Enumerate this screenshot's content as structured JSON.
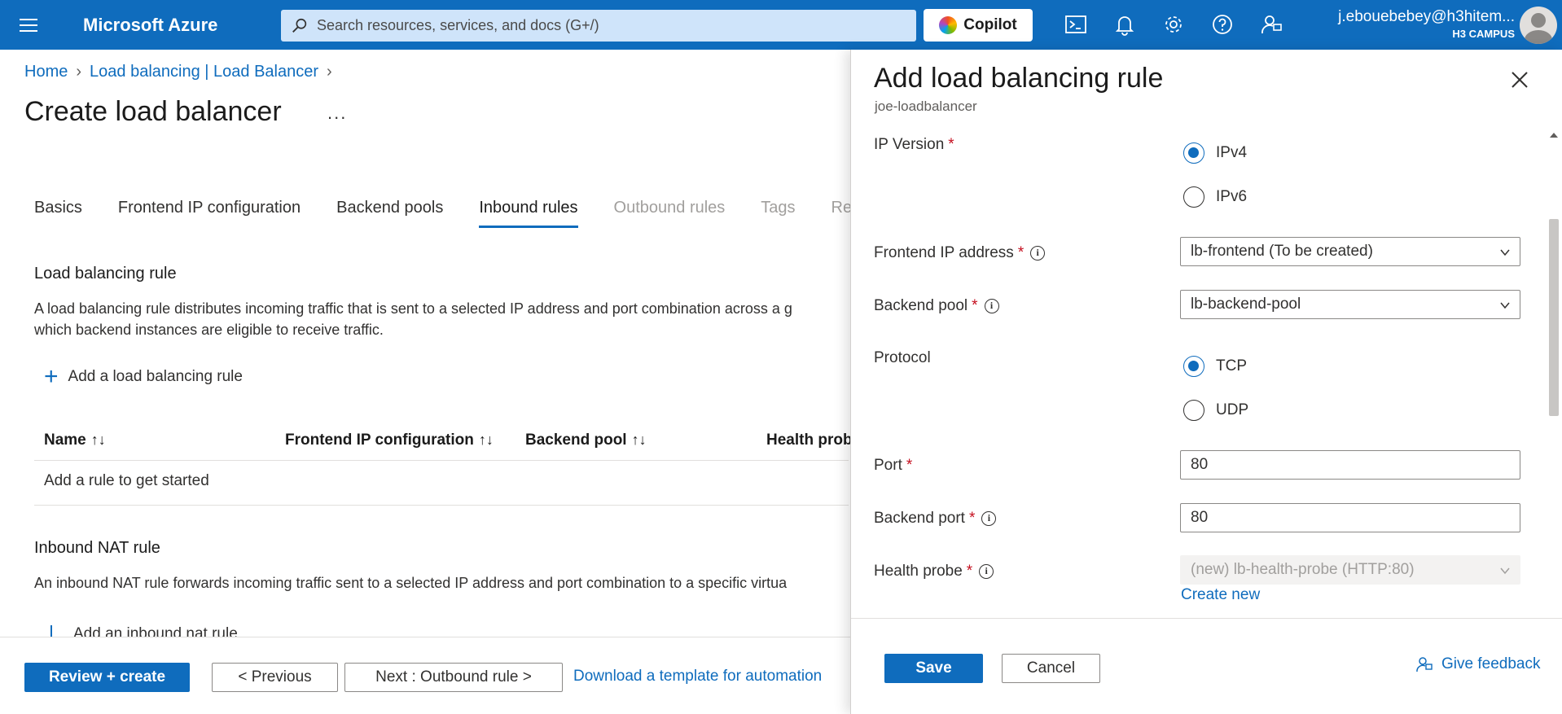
{
  "topbar": {
    "brand": "Microsoft Azure",
    "search_placeholder": "Search resources, services, and docs (G+/)",
    "copilot_label": "Copilot",
    "user_email": "j.ebouebebey@h3hitem...",
    "user_tenant": "H3 CAMPUS",
    "icons": [
      "menu-icon",
      "search-icon",
      "cloud-shell-icon",
      "notifications-icon",
      "settings-icon",
      "help-icon",
      "feedback-icon"
    ]
  },
  "breadcrumb": [
    "Home",
    "Load balancing | Load Balancer"
  ],
  "page": {
    "title": "Create load balancer",
    "more": "..."
  },
  "tabs": [
    {
      "label": "Basics",
      "state": "normal"
    },
    {
      "label": "Frontend IP configuration",
      "state": "normal"
    },
    {
      "label": "Backend pools",
      "state": "normal"
    },
    {
      "label": "Inbound rules",
      "state": "active"
    },
    {
      "label": "Outbound rules",
      "state": "disabled"
    },
    {
      "label": "Tags",
      "state": "disabled"
    },
    {
      "label": "Re",
      "state": "disabled"
    }
  ],
  "lb_rule_section": {
    "title": "Load balancing rule",
    "description_line1": "A load balancing rule distributes incoming traffic that is sent to a selected IP address and port combination across a g",
    "description_line2": "which backend instances are eligible to receive traffic.",
    "add_label": "Add a load balancing rule",
    "columns": [
      "Name",
      "Frontend IP configuration",
      "Backend pool",
      "Health prob"
    ],
    "empty_text": "Add a rule to get started"
  },
  "nat_section": {
    "title": "Inbound NAT rule",
    "description": "An inbound NAT rule forwards incoming traffic sent to a selected IP address and port combination to a specific virtua",
    "add_label": "Add an inbound nat rule"
  },
  "footer": {
    "review_create": "Review + create",
    "previous": "< Previous",
    "next": "Next : Outbound rule >",
    "download_template": "Download a template for automation"
  },
  "panel": {
    "title": "Add load balancing rule",
    "subtitle": "joe-loadbalancer",
    "ip_version": {
      "label": "IP Version",
      "options": [
        "IPv4",
        "IPv6"
      ],
      "selected": "IPv4"
    },
    "frontend_ip": {
      "label": "Frontend IP address",
      "value": "lb-frontend (To be created)"
    },
    "backend_pool": {
      "label": "Backend pool",
      "value": "lb-backend-pool"
    },
    "protocol": {
      "label": "Protocol",
      "options": [
        "TCP",
        "UDP"
      ],
      "selected": "TCP"
    },
    "port": {
      "label": "Port",
      "value": "80"
    },
    "backend_port": {
      "label": "Backend port",
      "value": "80"
    },
    "health_probe": {
      "label": "Health probe",
      "value": "(new) lb-health-probe (HTTP:80)",
      "create_new": "Create new"
    },
    "required_mark": "*",
    "save": "Save",
    "cancel": "Cancel",
    "give_feedback": "Give feedback"
  },
  "colors": {
    "accent": "#0f6cbd",
    "required": "#c50f1f"
  }
}
